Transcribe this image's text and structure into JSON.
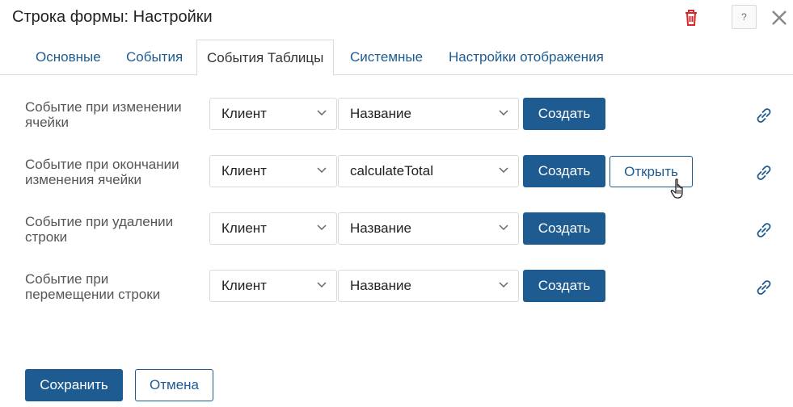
{
  "dialog": {
    "title": "Строка формы: Настройки",
    "help_label": "?"
  },
  "tabs": [
    {
      "label": "Основные",
      "active": false
    },
    {
      "label": "События",
      "active": false
    },
    {
      "label": "События Таблицы",
      "active": true
    },
    {
      "label": "Системные",
      "active": false
    },
    {
      "label": "Настройки отображения",
      "active": false
    }
  ],
  "events": [
    {
      "label": "Событие при изменении ячейки",
      "side": "Клиент",
      "script": "Название",
      "create_label": "Создать",
      "open_label": ""
    },
    {
      "label": "Событие при окончании изменения ячейки",
      "side": "Клиент",
      "script": "calculateTotal",
      "create_label": "Создать",
      "open_label": "Открыть"
    },
    {
      "label": "Событие при удалении строки",
      "side": "Клиент",
      "script": "Название",
      "create_label": "Создать",
      "open_label": ""
    },
    {
      "label": "Событие при перемещении строки",
      "side": "Клиент",
      "script": "Название",
      "create_label": "Создать",
      "open_label": ""
    }
  ],
  "footer": {
    "save_label": "Сохранить",
    "cancel_label": "Отмена"
  },
  "icons": {
    "trash": "trash-icon",
    "help": "help-icon",
    "close": "close-icon",
    "chevron": "chevron-down-icon",
    "link": "link-icon",
    "cursor": "hand-cursor-icon"
  },
  "colors": {
    "accent": "#1e5b91",
    "danger": "#d9262c",
    "border": "#d9d9d9"
  }
}
